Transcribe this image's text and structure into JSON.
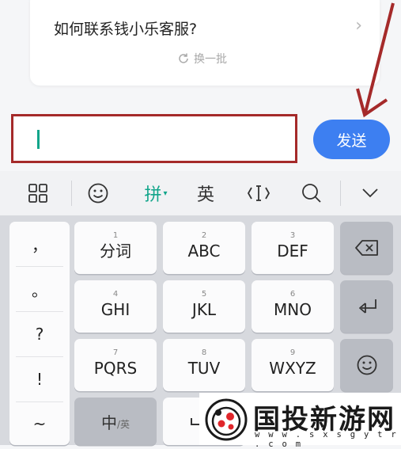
{
  "suggestion": {
    "question": "如何联系钱小乐客服?",
    "refresh_label": "换一批"
  },
  "input": {
    "value": "",
    "send_label": "发送"
  },
  "toolbar": {
    "pinyin_label": "拼",
    "english_label": "英"
  },
  "keyboard": {
    "punctuation": [
      "，",
      "。",
      "?",
      "!",
      "~"
    ],
    "keys": [
      {
        "num": "1",
        "label": "分词"
      },
      {
        "num": "2",
        "label": "ABC"
      },
      {
        "num": "3",
        "label": "DEF"
      },
      {
        "num": "4",
        "label": "GHI"
      },
      {
        "num": "5",
        "label": "JKL"
      },
      {
        "num": "6",
        "label": "MNO"
      },
      {
        "num": "7",
        "label": "PQRS"
      },
      {
        "num": "8",
        "label": "TUV"
      },
      {
        "num": "9",
        "label": "WXYZ"
      }
    ],
    "lang_switch_main": "中",
    "lang_switch_sub": "/英"
  },
  "watermark": {
    "title": "国投新游网",
    "url": "w w w . s x s g y t r . c o m"
  },
  "colors": {
    "accent": "#3d7ff1",
    "highlight_border": "#a52a2a",
    "cursor": "#11a58a",
    "pinyin_active": "#11a58a"
  }
}
